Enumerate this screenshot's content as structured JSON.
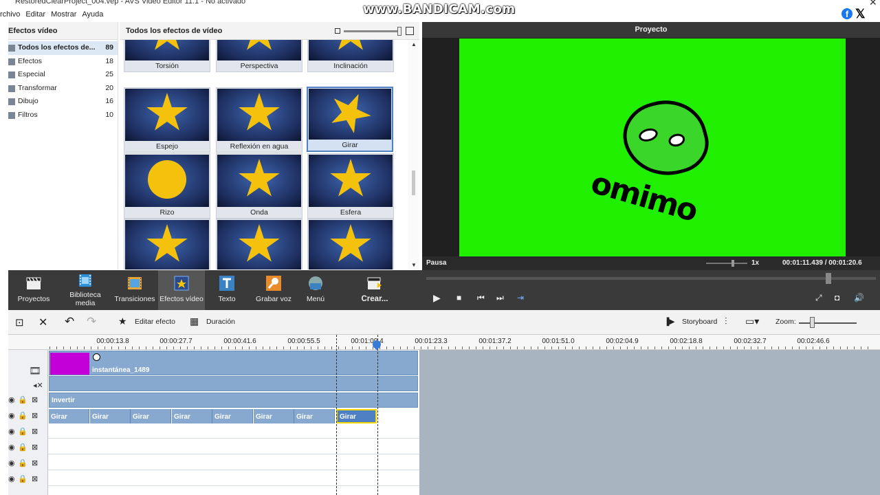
{
  "window": {
    "title": "RestoredClearProject_004.vep - AVS Video Editor 11.1 - No activado",
    "watermark": "www.BANDICAM.com"
  },
  "menu": [
    "rchivo",
    "Editar",
    "Mostrar",
    "Ayuda"
  ],
  "categories": {
    "header": "Efectos vídeo",
    "items": [
      {
        "label": "Todos los efectos de...",
        "count": "89"
      },
      {
        "label": "Efectos",
        "count": "18"
      },
      {
        "label": "Especial",
        "count": "25"
      },
      {
        "label": "Transformar",
        "count": "20"
      },
      {
        "label": "Dibujo",
        "count": "16"
      },
      {
        "label": "Filtros",
        "count": "10"
      }
    ]
  },
  "effects": {
    "header": "Todos los efectos de vídeo",
    "items": [
      "Torsión",
      "Perspectiva",
      "Inclinación",
      "Espejo",
      "Reflexión en agua",
      "Girar",
      "Rizo",
      "Onda",
      "Esfera",
      "",
      "",
      ""
    ]
  },
  "preview": {
    "header": "Proyecto",
    "status": "Pausa",
    "speed": "1x",
    "timecode": "00:01:11.439  /  00:01:20.6"
  },
  "toolbar": {
    "items": [
      "Proyectos",
      "Biblioteca media",
      "Transiciones",
      "Efectos vídeo",
      "Texto",
      "Grabar voz",
      "Menú",
      "Crear..."
    ]
  },
  "timeline": {
    "edit_effect": "Editar efecto",
    "duration": "Duración",
    "storyboard": "Storyboard",
    "zoom": "Zoom:",
    "ruler": [
      "00:00:13.8",
      "00:00:27.7",
      "00:00:41.6",
      "00:00:55.5",
      "00:01:09.4",
      "00:01:23.3",
      "00:01:37.2",
      "00:01:51.0",
      "00:02:04.9",
      "00:02:18.8",
      "00:02:32.7",
      "00:02:46.6"
    ],
    "video_clip": "instantánea_1489",
    "effect_track": "Invertir",
    "girar_clips": [
      "Girar",
      "Girar",
      "Girar",
      "Girar",
      "Girar",
      "Girar",
      "Girar",
      "Girar"
    ]
  }
}
